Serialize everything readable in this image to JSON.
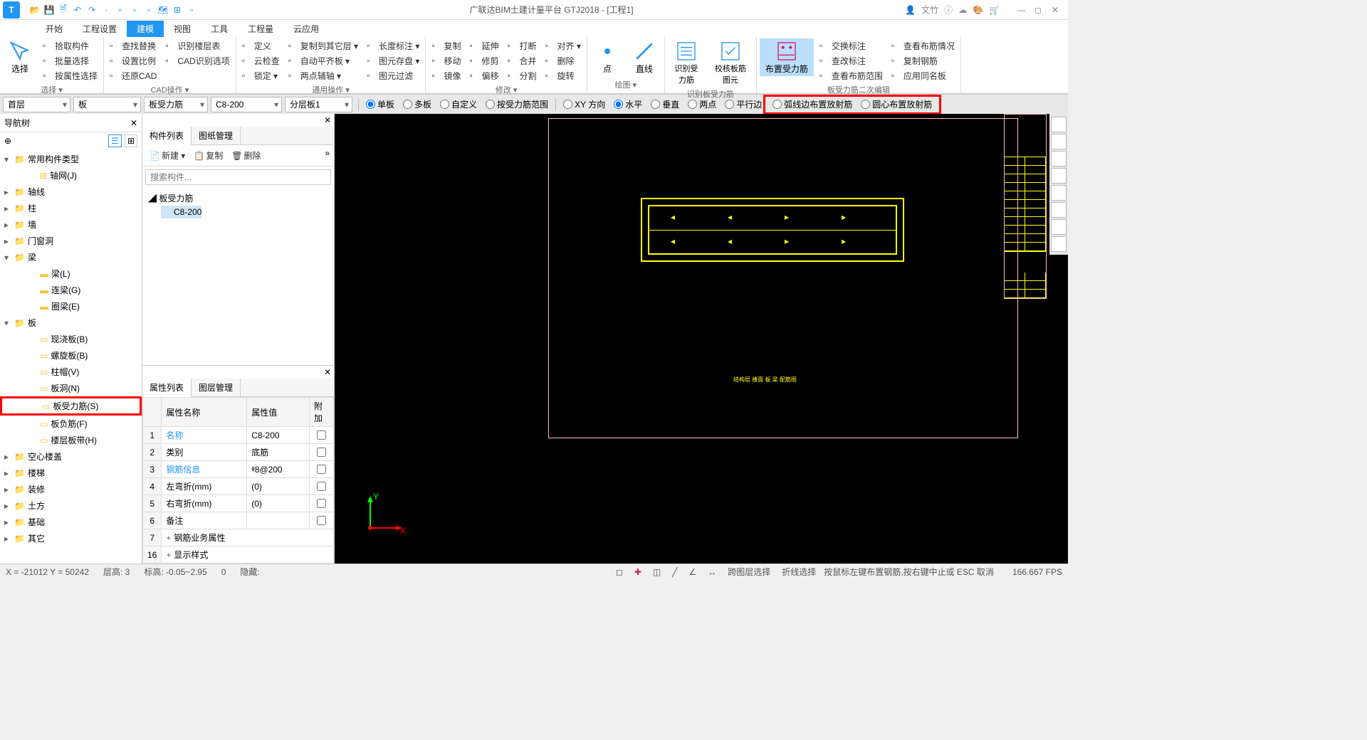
{
  "title": "广联达BIM土建计量平台 GTJ2018 - [工程1]",
  "user_label": "文竹",
  "menu": [
    "开始",
    "工程设置",
    "建模",
    "视图",
    "工具",
    "工程量",
    "云应用"
  ],
  "menu_active": 2,
  "ribbon": {
    "select_big": "选择",
    "group1": {
      "items": [
        "拾取构件",
        "批量选择",
        "按属性选择"
      ],
      "label": "选择 ▾"
    },
    "group2": {
      "col1": [
        "查找替换",
        "设置比例",
        "还原CAD"
      ],
      "col2": [
        "识别楼层表",
        "CAD识别选项"
      ],
      "label": "CAD操作 ▾"
    },
    "group3": {
      "col1": [
        "定义",
        "云检查",
        "锁定 ▾"
      ],
      "col2": [
        "复制到其它层 ▾",
        "自动平齐板 ▾",
        "两点辅轴 ▾"
      ],
      "col3": [
        "长度标注 ▾",
        "图元存盘 ▾",
        "图元过滤"
      ],
      "label": "通用操作 ▾"
    },
    "group4": {
      "col1": [
        "复制",
        "移动",
        "镜像"
      ],
      "col2": [
        "延伸",
        "修剪",
        "偏移"
      ],
      "col3": [
        "打断",
        "合并",
        "分割"
      ],
      "col4": [
        "对齐 ▾",
        "删除",
        "旋转"
      ],
      "label": "修改 ▾"
    },
    "group5": {
      "items": [
        "点",
        "直线"
      ],
      "label": "绘图 ▾"
    },
    "group6": {
      "items": [
        "识别受力筋",
        "校核板筋图元"
      ],
      "label": "识别板受力筋"
    },
    "group7_big": "布置受力筋",
    "group7": {
      "col1": [
        "交换标注",
        "查改标注",
        "查看布筋范围"
      ],
      "col2": [
        "查看布筋情况",
        "复制钢筋",
        "应用同名板"
      ],
      "label": "板受力筋二次编辑"
    }
  },
  "filter": {
    "selects": [
      "首层",
      "板",
      "板受力筋",
      "C8-200",
      "分层板1"
    ],
    "radios1": [
      {
        "label": "单板",
        "checked": true
      },
      {
        "label": "多板",
        "checked": false
      },
      {
        "label": "自定义",
        "checked": false
      },
      {
        "label": "按受力筋范围",
        "checked": false
      }
    ],
    "radios2": [
      {
        "label": "XY 方向",
        "checked": false
      },
      {
        "label": "水平",
        "checked": true
      },
      {
        "label": "垂直",
        "checked": false
      },
      {
        "label": "两点",
        "checked": false
      },
      {
        "label": "平行边",
        "checked": false
      }
    ],
    "radios3": [
      {
        "label": "弧线边布置放射筋",
        "checked": false
      },
      {
        "label": "圆心布置放射筋",
        "checked": false
      }
    ]
  },
  "nav": {
    "title": "导航树",
    "items": [
      {
        "t": "常用构件类型",
        "exp": "▾",
        "lvl": 0,
        "ico": "📁"
      },
      {
        "t": "轴网(J)",
        "lvl": 2,
        "ico": "⊞"
      },
      {
        "t": "轴线",
        "exp": "▸",
        "lvl": 0,
        "ico": "📁"
      },
      {
        "t": "柱",
        "exp": "▸",
        "lvl": 0,
        "ico": "📁"
      },
      {
        "t": "墙",
        "exp": "▸",
        "lvl": 0,
        "ico": "📁"
      },
      {
        "t": "门窗洞",
        "exp": "▸",
        "lvl": 0,
        "ico": "📁"
      },
      {
        "t": "梁",
        "exp": "▾",
        "lvl": 0,
        "ico": "📁"
      },
      {
        "t": "梁(L)",
        "lvl": 2,
        "ico": "▬"
      },
      {
        "t": "连梁(G)",
        "lvl": 2,
        "ico": "▬"
      },
      {
        "t": "圈梁(E)",
        "lvl": 2,
        "ico": "▬"
      },
      {
        "t": "板",
        "exp": "▾",
        "lvl": 0,
        "ico": "📁"
      },
      {
        "t": "现浇板(B)",
        "lvl": 2,
        "ico": "▭"
      },
      {
        "t": "螺旋板(B)",
        "lvl": 2,
        "ico": "▭"
      },
      {
        "t": "柱帽(V)",
        "lvl": 2,
        "ico": "▭"
      },
      {
        "t": "板洞(N)",
        "lvl": 2,
        "ico": "▭"
      },
      {
        "t": "板受力筋(S)",
        "lvl": 2,
        "ico": "▭",
        "hl": true
      },
      {
        "t": "板负筋(F)",
        "lvl": 2,
        "ico": "▭"
      },
      {
        "t": "楼层板带(H)",
        "lvl": 2,
        "ico": "▭"
      },
      {
        "t": "空心楼盖",
        "exp": "▸",
        "lvl": 0,
        "ico": "📁"
      },
      {
        "t": "楼梯",
        "exp": "▸",
        "lvl": 0,
        "ico": "📁"
      },
      {
        "t": "装修",
        "exp": "▸",
        "lvl": 0,
        "ico": "📁"
      },
      {
        "t": "土方",
        "exp": "▸",
        "lvl": 0,
        "ico": "📁"
      },
      {
        "t": "基础",
        "exp": "▸",
        "lvl": 0,
        "ico": "📁"
      },
      {
        "t": "其它",
        "exp": "▸",
        "lvl": 0,
        "ico": "📁"
      }
    ]
  },
  "comp_panel": {
    "tabs": [
      "构件列表",
      "图纸管理"
    ],
    "toolbar": [
      "新建 ▾",
      "复制",
      "删除"
    ],
    "search_placeholder": "搜索构件...",
    "root": "板受力筋",
    "item": "C8-200"
  },
  "prop_panel": {
    "tabs": [
      "属性列表",
      "图层管理"
    ],
    "headers": [
      "",
      "属性名称",
      "属性值",
      "附加"
    ],
    "rows": [
      {
        "n": "1",
        "name": "名称",
        "val": "C8-200",
        "link": true,
        "chk": false
      },
      {
        "n": "2",
        "name": "类别",
        "val": "底筋",
        "chk": true
      },
      {
        "n": "3",
        "name": "钢筋信息",
        "val": "ᶲ8@200",
        "link": true,
        "chk": true
      },
      {
        "n": "4",
        "name": "左弯折(mm)",
        "val": "(0)",
        "chk": true
      },
      {
        "n": "5",
        "name": "右弯折(mm)",
        "val": "(0)",
        "chk": true
      },
      {
        "n": "6",
        "name": "备注",
        "val": "",
        "chk": true
      },
      {
        "n": "7",
        "name": "钢筋业务属性",
        "exp": "+"
      },
      {
        "n": "16",
        "name": "显示样式",
        "exp": "+"
      }
    ]
  },
  "status": {
    "coords": "X = -21012 Y = 50242",
    "floor": "层高:   3",
    "elev": "标高:   -0.05~2.95",
    "angle": "0",
    "hidden": "隐藏:",
    "cross_layer": "跨图层选择",
    "polyline": "折线选择",
    "hint": "按鼠标左键布置钢筋,按右键中止或 ESC 取消",
    "fps": "166.667 FPS"
  },
  "axis": {
    "x": "X",
    "y": "Y"
  }
}
